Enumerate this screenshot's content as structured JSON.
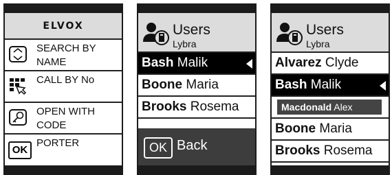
{
  "screen1": {
    "logo": "ELVOX",
    "menu": [
      {
        "icon": "search-icon",
        "label": "SEARCH BY NAME"
      },
      {
        "icon": "keypad-icon",
        "label": "CALL BY No"
      },
      {
        "icon": "key-icon",
        "label": "OPEN WITH CODE"
      },
      {
        "icon": "ok-icon",
        "label": "PORTER",
        "icon_text": "OK"
      }
    ]
  },
  "screen2": {
    "title": "Users",
    "subtitle": "Lybra",
    "rows": [
      {
        "surname": "Bash",
        "first": "Malik",
        "selected": true
      },
      {
        "surname": "Boone",
        "first": "Maria"
      },
      {
        "surname": "Brooks",
        "first": "Rosema"
      }
    ],
    "footer": {
      "ok": "OK",
      "label": "Back"
    }
  },
  "screen3": {
    "title": "Users",
    "subtitle": "Lybra",
    "rows": [
      {
        "surname": "Alvarez",
        "first": "Clyde"
      },
      {
        "surname": "Bash",
        "first": "Malik",
        "selected": true
      },
      {
        "surname": "Macdonald",
        "first": "Alex",
        "ghost": true
      },
      {
        "surname": "Boone",
        "first": "Maria"
      },
      {
        "surname": "Brooks",
        "first": "Rosema"
      }
    ]
  }
}
